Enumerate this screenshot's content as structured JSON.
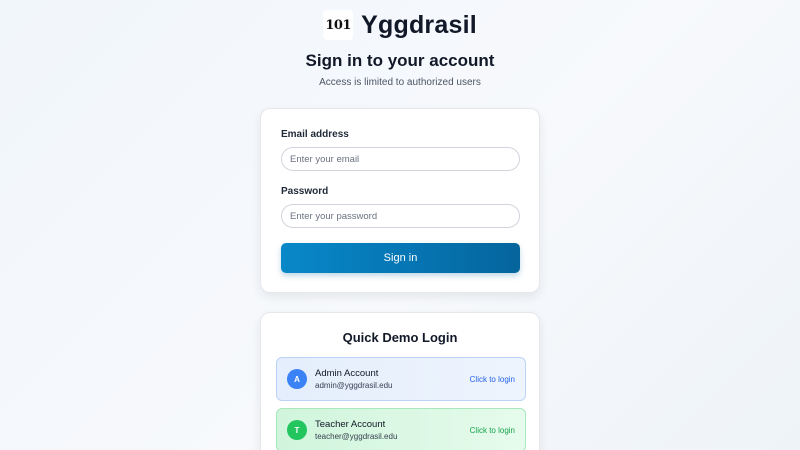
{
  "brand": {
    "logo_text": "101",
    "name": "Yggdrasil"
  },
  "header": {
    "title": "Sign in to your account",
    "subtitle": "Access is limited to authorized users"
  },
  "form": {
    "email_label": "Email address",
    "email_placeholder": "Enter your email",
    "email_value": "",
    "password_label": "Password",
    "password_placeholder": "Enter your password",
    "password_value": "",
    "submit_label": "Sign in"
  },
  "demo": {
    "title": "Quick Demo Login",
    "accounts": [
      {
        "initial": "A",
        "name": "Admin Account",
        "email": "admin@yggdrasil.edu",
        "action": "Click to login",
        "color": "#3b82f6"
      },
      {
        "initial": "T",
        "name": "Teacher Account",
        "email": "teacher@yggdrasil.edu",
        "action": "Click to login",
        "color": "#22c55e"
      }
    ]
  },
  "colors": {
    "primary_button": "#0675b3",
    "admin_accent": "#3b82f6",
    "teacher_accent": "#22c55e"
  }
}
